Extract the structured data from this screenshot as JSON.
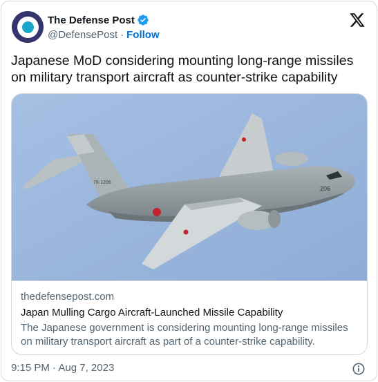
{
  "author": {
    "display_name": "The Defense Post",
    "handle": "@DefensePost",
    "separator": "·",
    "follow_label": "Follow",
    "verified": true
  },
  "tweet": {
    "text": "Japanese MoD considering mounting long-range missiles on military transport aircraft as counter-strike capability"
  },
  "card": {
    "domain": "thedefensepost.com",
    "title": "Japan Mulling Cargo Aircraft-Launched Missile Capability",
    "description": "The Japanese government is considering mounting long-range missiles on military transport aircraft as part of a counter-strike capability.",
    "image_alt": "Military transport aircraft in flight against a blue sky",
    "aircraft_tail_marking": "78-1206",
    "aircraft_nose_number": "206"
  },
  "footer": {
    "time": "9:15 PM",
    "separator": "·",
    "date": "Aug 7, 2023"
  },
  "icons": {
    "brand": "x-logo-icon",
    "verified": "verified-badge-icon",
    "info": "info-icon"
  },
  "colors": {
    "link_blue": "#006fd6",
    "verified_blue": "#1d9bf0",
    "muted_text": "#536471",
    "border": "#cfd9de",
    "avatar_dark": "#35356d",
    "avatar_accent": "#1aa6c9"
  }
}
